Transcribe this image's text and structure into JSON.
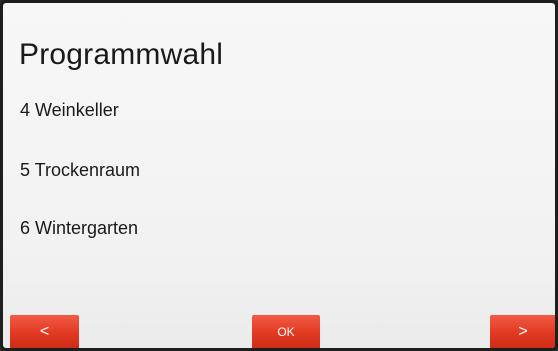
{
  "screen": {
    "title": "Programmwahl",
    "items": [
      {
        "label": "4 Weinkeller"
      },
      {
        "label": "5 Trockenraum"
      },
      {
        "label": "6 Wintergarten"
      }
    ]
  },
  "softkeys": {
    "prev_label": "<",
    "ok_label": "OK",
    "next_label": ">"
  },
  "colors": {
    "background": "#f4f4f4",
    "softkey_red": "#e23a23",
    "text": "#1a1a1a"
  }
}
